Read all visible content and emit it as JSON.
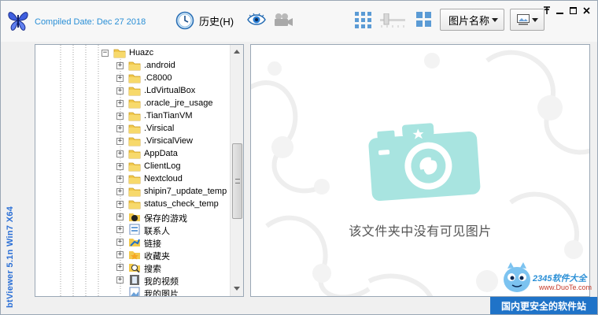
{
  "app": {
    "vertical_title": "btViewer 5.1n Win7 X64",
    "compiled": "Compiled Date: Dec 27 2018"
  },
  "toolbar": {
    "history_label": "历史(H)",
    "sort_label": "图片名称",
    "icons": [
      "logo-butterfly-icon",
      "history-clock-icon",
      "eye-icon",
      "camera-video-icon",
      "grid-large-icon",
      "slider-icon",
      "grid-small-icon",
      "thumbnail-view-icon"
    ]
  },
  "window_controls": [
    "pin",
    "minimize",
    "maximize",
    "close"
  ],
  "tree": {
    "root": "Huazc",
    "items": [
      {
        "label": ".android",
        "icon": "folder"
      },
      {
        "label": ".C8000",
        "icon": "folder"
      },
      {
        "label": ".LdVirtualBox",
        "icon": "folder"
      },
      {
        "label": ".oracle_jre_usage",
        "icon": "folder"
      },
      {
        "label": ".TianTianVM",
        "icon": "folder"
      },
      {
        "label": ".Virsical",
        "icon": "folder"
      },
      {
        "label": ".VirsicalView",
        "icon": "folder"
      },
      {
        "label": "AppData",
        "icon": "folder"
      },
      {
        "label": "ClientLog",
        "icon": "folder"
      },
      {
        "label": "Nextcloud",
        "icon": "folder"
      },
      {
        "label": "shipin7_update_temp",
        "icon": "folder"
      },
      {
        "label": "status_check_temp",
        "icon": "folder"
      },
      {
        "label": "保存的游戏",
        "icon": "saved-games"
      },
      {
        "label": "联系人",
        "icon": "contacts"
      },
      {
        "label": "链接",
        "icon": "links"
      },
      {
        "label": "收藏夹",
        "icon": "favorites"
      },
      {
        "label": "搜索",
        "icon": "search"
      },
      {
        "label": "我的视频",
        "icon": "videos"
      },
      {
        "label": "我的图片",
        "icon": "pictures"
      }
    ]
  },
  "preview": {
    "empty_message": "该文件夹中没有可见图片"
  },
  "watermark": {
    "brand": "2345软件大全",
    "url": "www.DuoTe.com",
    "bar": "国内更安全的软件站"
  },
  "colors": {
    "accent": "#2a8fd6",
    "camera": "#a8e4e0",
    "folder": "#f2c94c",
    "watermark_bar": "#1f73c8"
  }
}
